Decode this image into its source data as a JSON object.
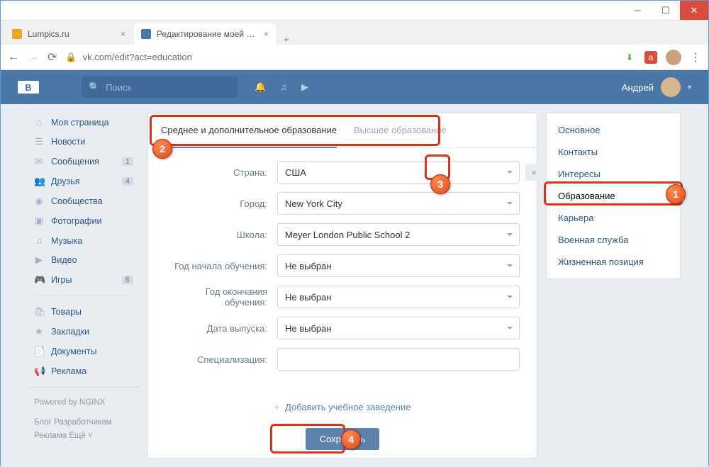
{
  "browser": {
    "tabs": [
      {
        "label": "Lumpics.ru",
        "favicon": "#f5a623",
        "active": false
      },
      {
        "label": "Редактирование моей страницы",
        "favicon": "#4a76a8",
        "active": true
      }
    ],
    "url": "vk.com/edit?act=education"
  },
  "vk": {
    "search_placeholder": "Поиск",
    "user_name": "Андрей",
    "left_nav": [
      {
        "icon": "⌂",
        "label": "Моя страница"
      },
      {
        "icon": "☰",
        "label": "Новости"
      },
      {
        "icon": "✉",
        "label": "Сообщения",
        "badge": "1"
      },
      {
        "icon": "👥",
        "label": "Друзья",
        "badge": "4"
      },
      {
        "icon": "◉",
        "label": "Сообщества"
      },
      {
        "icon": "▣",
        "label": "Фотографии"
      },
      {
        "icon": "♫",
        "label": "Музыка"
      },
      {
        "icon": "▶",
        "label": "Видео"
      },
      {
        "icon": "🎮",
        "label": "Игры",
        "badge": "6"
      }
    ],
    "left_nav2": [
      {
        "icon": "🛍",
        "label": "Товары"
      },
      {
        "icon": "★",
        "label": "Закладки"
      },
      {
        "icon": "📄",
        "label": "Документы"
      },
      {
        "icon": "📢",
        "label": "Реклама"
      }
    ],
    "powered": "Powered by NGINX",
    "footer": [
      "Блог",
      "Разработчикам",
      "Реклама",
      "Ещё ˅"
    ],
    "right_nav": [
      "Основное",
      "Контакты",
      "Интересы",
      "Образование",
      "Карьера",
      "Военная служба",
      "Жизненная позиция"
    ],
    "right_nav_active": 3,
    "main_tabs": [
      "Среднее и дополнительное образование",
      "Высшее образование"
    ],
    "main_tab_active": 0,
    "form": {
      "rows": [
        {
          "label": "Страна:",
          "value": "США",
          "type": "select",
          "clearable": true
        },
        {
          "label": "Город:",
          "value": "New York City",
          "type": "select"
        },
        {
          "label": "Школа:",
          "value": "Meyer London Public School 2",
          "type": "select"
        },
        {
          "label": "Год начала обучения:",
          "value": "Не выбран",
          "type": "select"
        },
        {
          "label": "Год окончания обучения:",
          "value": "Не выбран",
          "type": "select"
        },
        {
          "label": "Дата выпуска:",
          "value": "Не выбран",
          "type": "select"
        },
        {
          "label": "Специализация:",
          "value": "",
          "type": "input"
        }
      ],
      "add_link": "Добавить учебное заведение",
      "save": "Сохранить"
    }
  },
  "annotations": {
    "1": "1",
    "2": "2",
    "3": "3",
    "4": "4"
  }
}
